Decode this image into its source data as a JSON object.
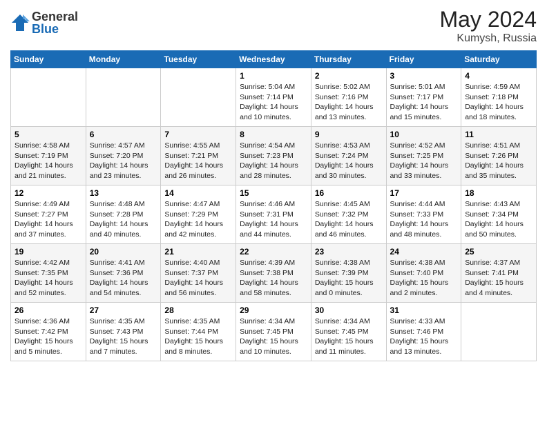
{
  "header": {
    "logo_general": "General",
    "logo_blue": "Blue",
    "month_year": "May 2024",
    "location": "Kumysh, Russia"
  },
  "weekdays": [
    "Sunday",
    "Monday",
    "Tuesday",
    "Wednesday",
    "Thursday",
    "Friday",
    "Saturday"
  ],
  "weeks": [
    [
      {
        "day": "",
        "info": ""
      },
      {
        "day": "",
        "info": ""
      },
      {
        "day": "",
        "info": ""
      },
      {
        "day": "1",
        "info": "Sunrise: 5:04 AM\nSunset: 7:14 PM\nDaylight: 14 hours\nand 10 minutes."
      },
      {
        "day": "2",
        "info": "Sunrise: 5:02 AM\nSunset: 7:16 PM\nDaylight: 14 hours\nand 13 minutes."
      },
      {
        "day": "3",
        "info": "Sunrise: 5:01 AM\nSunset: 7:17 PM\nDaylight: 14 hours\nand 15 minutes."
      },
      {
        "day": "4",
        "info": "Sunrise: 4:59 AM\nSunset: 7:18 PM\nDaylight: 14 hours\nand 18 minutes."
      }
    ],
    [
      {
        "day": "5",
        "info": "Sunrise: 4:58 AM\nSunset: 7:19 PM\nDaylight: 14 hours\nand 21 minutes."
      },
      {
        "day": "6",
        "info": "Sunrise: 4:57 AM\nSunset: 7:20 PM\nDaylight: 14 hours\nand 23 minutes."
      },
      {
        "day": "7",
        "info": "Sunrise: 4:55 AM\nSunset: 7:21 PM\nDaylight: 14 hours\nand 26 minutes."
      },
      {
        "day": "8",
        "info": "Sunrise: 4:54 AM\nSunset: 7:23 PM\nDaylight: 14 hours\nand 28 minutes."
      },
      {
        "day": "9",
        "info": "Sunrise: 4:53 AM\nSunset: 7:24 PM\nDaylight: 14 hours\nand 30 minutes."
      },
      {
        "day": "10",
        "info": "Sunrise: 4:52 AM\nSunset: 7:25 PM\nDaylight: 14 hours\nand 33 minutes."
      },
      {
        "day": "11",
        "info": "Sunrise: 4:51 AM\nSunset: 7:26 PM\nDaylight: 14 hours\nand 35 minutes."
      }
    ],
    [
      {
        "day": "12",
        "info": "Sunrise: 4:49 AM\nSunset: 7:27 PM\nDaylight: 14 hours\nand 37 minutes."
      },
      {
        "day": "13",
        "info": "Sunrise: 4:48 AM\nSunset: 7:28 PM\nDaylight: 14 hours\nand 40 minutes."
      },
      {
        "day": "14",
        "info": "Sunrise: 4:47 AM\nSunset: 7:29 PM\nDaylight: 14 hours\nand 42 minutes."
      },
      {
        "day": "15",
        "info": "Sunrise: 4:46 AM\nSunset: 7:31 PM\nDaylight: 14 hours\nand 44 minutes."
      },
      {
        "day": "16",
        "info": "Sunrise: 4:45 AM\nSunset: 7:32 PM\nDaylight: 14 hours\nand 46 minutes."
      },
      {
        "day": "17",
        "info": "Sunrise: 4:44 AM\nSunset: 7:33 PM\nDaylight: 14 hours\nand 48 minutes."
      },
      {
        "day": "18",
        "info": "Sunrise: 4:43 AM\nSunset: 7:34 PM\nDaylight: 14 hours\nand 50 minutes."
      }
    ],
    [
      {
        "day": "19",
        "info": "Sunrise: 4:42 AM\nSunset: 7:35 PM\nDaylight: 14 hours\nand 52 minutes."
      },
      {
        "day": "20",
        "info": "Sunrise: 4:41 AM\nSunset: 7:36 PM\nDaylight: 14 hours\nand 54 minutes."
      },
      {
        "day": "21",
        "info": "Sunrise: 4:40 AM\nSunset: 7:37 PM\nDaylight: 14 hours\nand 56 minutes."
      },
      {
        "day": "22",
        "info": "Sunrise: 4:39 AM\nSunset: 7:38 PM\nDaylight: 14 hours\nand 58 minutes."
      },
      {
        "day": "23",
        "info": "Sunrise: 4:38 AM\nSunset: 7:39 PM\nDaylight: 15 hours\nand 0 minutes."
      },
      {
        "day": "24",
        "info": "Sunrise: 4:38 AM\nSunset: 7:40 PM\nDaylight: 15 hours\nand 2 minutes."
      },
      {
        "day": "25",
        "info": "Sunrise: 4:37 AM\nSunset: 7:41 PM\nDaylight: 15 hours\nand 4 minutes."
      }
    ],
    [
      {
        "day": "26",
        "info": "Sunrise: 4:36 AM\nSunset: 7:42 PM\nDaylight: 15 hours\nand 5 minutes."
      },
      {
        "day": "27",
        "info": "Sunrise: 4:35 AM\nSunset: 7:43 PM\nDaylight: 15 hours\nand 7 minutes."
      },
      {
        "day": "28",
        "info": "Sunrise: 4:35 AM\nSunset: 7:44 PM\nDaylight: 15 hours\nand 8 minutes."
      },
      {
        "day": "29",
        "info": "Sunrise: 4:34 AM\nSunset: 7:45 PM\nDaylight: 15 hours\nand 10 minutes."
      },
      {
        "day": "30",
        "info": "Sunrise: 4:34 AM\nSunset: 7:45 PM\nDaylight: 15 hours\nand 11 minutes."
      },
      {
        "day": "31",
        "info": "Sunrise: 4:33 AM\nSunset: 7:46 PM\nDaylight: 15 hours\nand 13 minutes."
      },
      {
        "day": "",
        "info": ""
      }
    ]
  ]
}
